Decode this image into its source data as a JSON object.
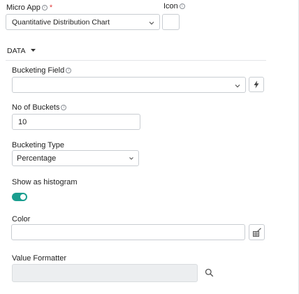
{
  "micro_app": {
    "label": "Micro App",
    "required_mark": "*",
    "value": "Quantitative Distribution Chart"
  },
  "icon_field": {
    "label": "Icon"
  },
  "data_section": {
    "title": "DATA"
  },
  "bucketing_field": {
    "label": "Bucketing Field",
    "value": ""
  },
  "no_of_buckets": {
    "label": "No of Buckets",
    "value": "10"
  },
  "bucketing_type": {
    "label": "Bucketing Type",
    "value": "Percentage"
  },
  "histogram": {
    "label": "Show as histogram",
    "enabled": true
  },
  "color": {
    "label": "Color",
    "value": ""
  },
  "value_formatter": {
    "label": "Value Formatter",
    "value": ""
  },
  "colors": {
    "accent": "#1a9e8f",
    "border": "#c9cdd2",
    "disabled_bg": "#eceef0",
    "required": "#e03b3b"
  },
  "icons": {
    "info": "info-icon",
    "chevron": "chevron-down-icon",
    "caret": "caret-down-icon",
    "lightning": "lightning-icon",
    "palette": "color-picker-icon",
    "search": "search-icon"
  }
}
